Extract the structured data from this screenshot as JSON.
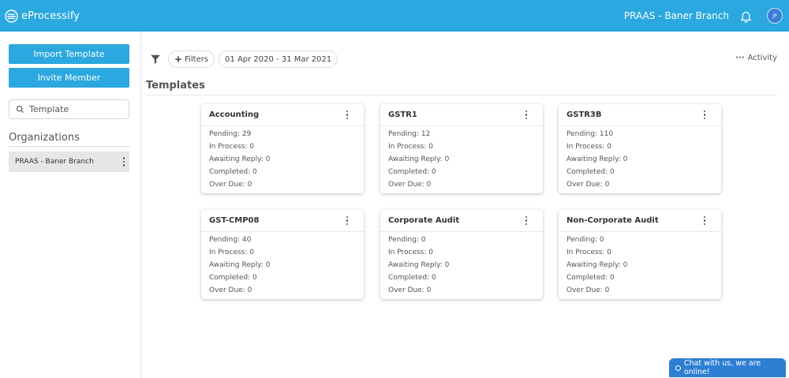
{
  "app": {
    "name": "eProcessify"
  },
  "header": {
    "branch": "PRAAS - Baner Branch",
    "avatar_initials": "JP"
  },
  "sidebar": {
    "import_label": "Import Template",
    "invite_label": "Invite Member",
    "search_placeholder": "Template",
    "org_title": "Organizations",
    "orgs": [
      {
        "label": "PRAAS - Baner Branch"
      }
    ]
  },
  "toolbar": {
    "filters_label": "Filters",
    "date_range": "01 Apr 2020 - 31 Mar 2021",
    "activity_label": "Activity"
  },
  "main": {
    "section_title": "Templates",
    "labels": {
      "pending": "Pending:",
      "in_process": "In Process:",
      "awaiting": "Awaiting Reply:",
      "completed": "Completed:",
      "overdue": "Over Due:"
    },
    "cards": [
      {
        "title": "Accounting",
        "pending": "29",
        "in_process": "0",
        "awaiting": "0",
        "completed": "0",
        "overdue": "0"
      },
      {
        "title": "GSTR1",
        "pending": "12",
        "in_process": "0",
        "awaiting": "0",
        "completed": "0",
        "overdue": "0"
      },
      {
        "title": "GSTR3B",
        "pending": "110",
        "in_process": "0",
        "awaiting": "0",
        "completed": "0",
        "overdue": "0"
      },
      {
        "title": "GST-CMP08",
        "pending": "40",
        "in_process": "0",
        "awaiting": "0",
        "completed": "0",
        "overdue": "0"
      },
      {
        "title": "Corporate Audit",
        "pending": "0",
        "in_process": "0",
        "awaiting": "0",
        "completed": "0",
        "overdue": "0"
      },
      {
        "title": "Non-Corporate Audit",
        "pending": "0",
        "in_process": "0",
        "awaiting": "0",
        "completed": "0",
        "overdue": "0"
      }
    ]
  },
  "chat": {
    "label": "Chat with us, we are online!"
  },
  "colors": {
    "primary": "#2aa8df",
    "chat": "#2d7fd3"
  }
}
